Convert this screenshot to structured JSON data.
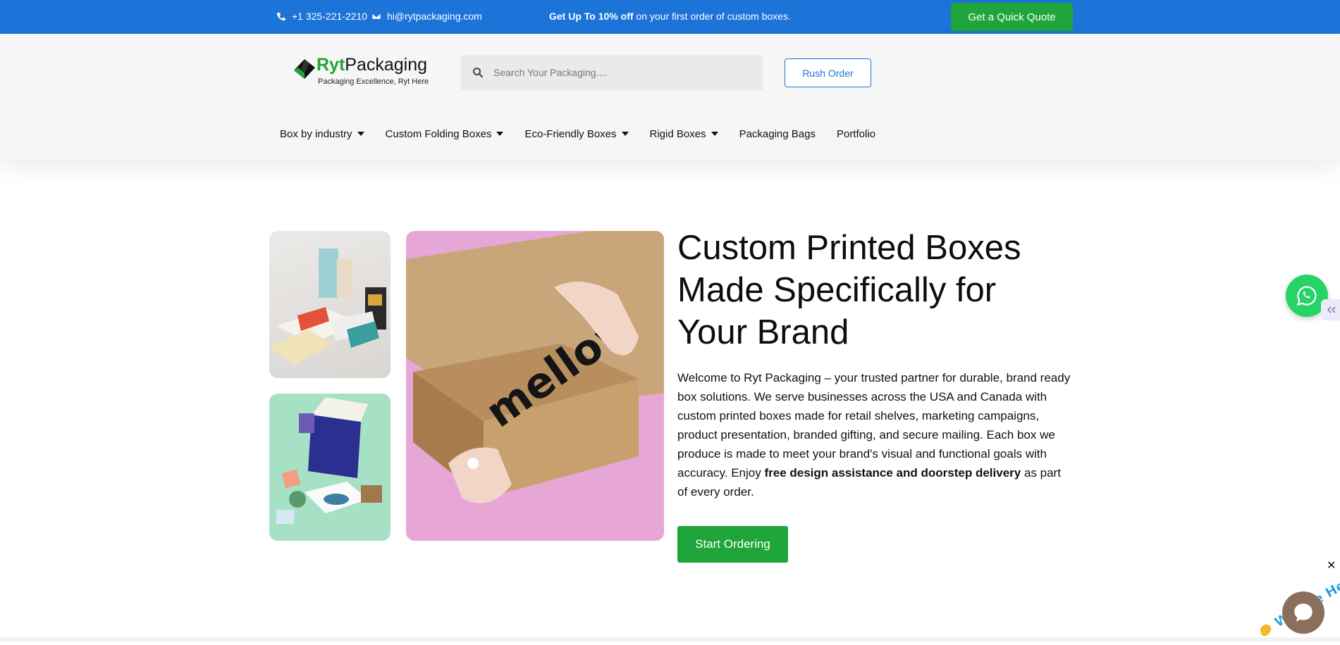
{
  "topbar": {
    "phone": "+1 325-221-2210",
    "email": "hi@rytpackaging.com",
    "promo_bold": "Get Up To 10% off",
    "promo_rest": " on your first order of custom boxes.",
    "quote_button": "Get a Quick Quote",
    "bg_color": "#1c73d8",
    "button_color": "#1fa53a"
  },
  "header": {
    "logo_ryt": "Ryt",
    "logo_packaging": "Packaging",
    "logo_tagline": "Packaging Excellence, Ryt Here",
    "search_placeholder": "Search Your Packaging....",
    "rush_button": "Rush Order"
  },
  "nav": {
    "items": [
      {
        "label": "Box by industry",
        "has_dropdown": true
      },
      {
        "label": "Custom Folding Boxes",
        "has_dropdown": true
      },
      {
        "label": "Eco-Friendly Boxes",
        "has_dropdown": true
      },
      {
        "label": "Rigid Boxes",
        "has_dropdown": true
      },
      {
        "label": "Packaging Bags",
        "has_dropdown": false
      },
      {
        "label": "Portfolio",
        "has_dropdown": false
      }
    ]
  },
  "hero": {
    "title": "Custom Printed Boxes Made Specifically for Your Brand",
    "text_part1": "Welcome to Ryt Packaging – your trusted partner for durable, brand ready box solutions. We serve businesses across the USA and Canada with custom printed boxes made for retail shelves, marketing campaigns, product presentation, branded gifting, and secure mailing. Each box we produce is made to meet your brand's visual and functional goals with accuracy. Enjoy ",
    "text_bold": "free design assistance and doorstep delivery",
    "text_part2": " as part of every order.",
    "cta_button": "Start Ordering",
    "box_print_text": "mellow"
  },
  "widgets": {
    "chat_badge_text": "We Are Here!",
    "close_symbol": "✕"
  }
}
